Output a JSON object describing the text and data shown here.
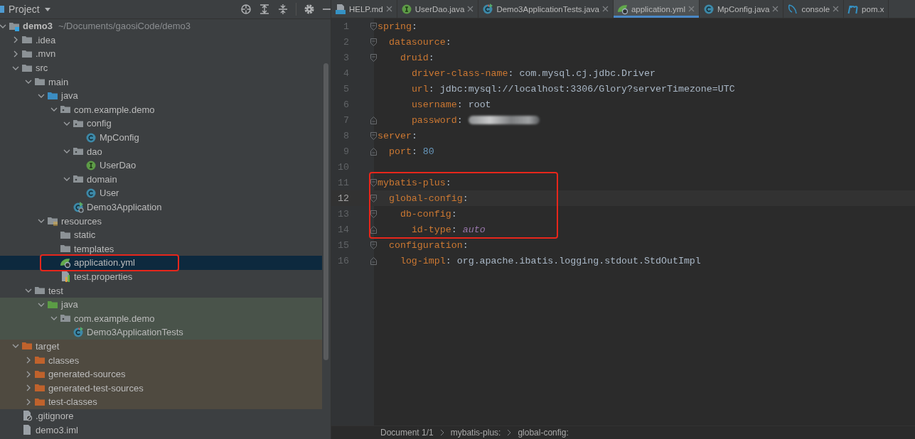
{
  "project": {
    "title": "Project",
    "tree": {
      "name": "demo3",
      "path_hint": "~/Documents/gaosiCode/demo3",
      "kind": "module",
      "expanded": true,
      "selected": false,
      "children": [
        {
          "name": ".idea",
          "kind": "folder",
          "expanded": false,
          "selected": false
        },
        {
          "name": ".mvn",
          "kind": "folder",
          "expanded": false,
          "selected": false
        },
        {
          "name": "src",
          "kind": "folder",
          "expanded": true,
          "selected": false,
          "children": [
            {
              "name": "main",
              "kind": "folder",
              "expanded": true,
              "selected": false,
              "children": [
                {
                  "name": "java",
                  "kind": "source-folder",
                  "expanded": true,
                  "selected": false,
                  "children": [
                    {
                      "name": "com.example.demo",
                      "kind": "package",
                      "expanded": true,
                      "selected": false,
                      "children": [
                        {
                          "name": "config",
                          "kind": "package",
                          "expanded": true,
                          "selected": false,
                          "children": [
                            {
                              "name": "MpConfig",
                              "kind": "class",
                              "selected": false
                            }
                          ]
                        },
                        {
                          "name": "dao",
                          "kind": "package",
                          "expanded": true,
                          "selected": false,
                          "children": [
                            {
                              "name": "UserDao",
                              "kind": "interface",
                              "selected": false
                            }
                          ]
                        },
                        {
                          "name": "domain",
                          "kind": "package",
                          "expanded": true,
                          "selected": false,
                          "children": [
                            {
                              "name": "User",
                              "kind": "class",
                              "selected": false
                            }
                          ]
                        },
                        {
                          "name": "Demo3Application",
                          "kind": "app-class",
                          "selected": false
                        }
                      ]
                    }
                  ]
                },
                {
                  "name": "resources",
                  "kind": "resources",
                  "expanded": true,
                  "selected": false,
                  "children": [
                    {
                      "name": "static",
                      "kind": "folder",
                      "selected": false
                    },
                    {
                      "name": "templates",
                      "kind": "folder",
                      "selected": false
                    },
                    {
                      "name": "application.yml",
                      "kind": "yml",
                      "selected": true,
                      "boxed": true
                    },
                    {
                      "name": "test.properties",
                      "kind": "properties",
                      "selected": false
                    }
                  ]
                }
              ]
            },
            {
              "name": "test",
              "kind": "folder",
              "expanded": true,
              "selected": false,
              "children": [
                {
                  "name": "java",
                  "kind": "test-folder",
                  "test_source": true,
                  "expanded": true,
                  "selected": false,
                  "children": [
                    {
                      "name": "com.example.demo",
                      "kind": "package",
                      "test_source": true,
                      "expanded": true,
                      "selected": false,
                      "children": [
                        {
                          "name": "Demo3ApplicationTests",
                          "kind": "test-class",
                          "test_source": true,
                          "selected": false
                        }
                      ]
                    }
                  ]
                }
              ]
            }
          ]
        },
        {
          "name": "target",
          "kind": "excluded-folder",
          "excluded": true,
          "expanded": true,
          "selected": false,
          "children": [
            {
              "name": "classes",
              "kind": "excluded-folder",
              "excluded": true,
              "expanded": false,
              "selected": false
            },
            {
              "name": "generated-sources",
              "kind": "excluded-folder",
              "excluded": true,
              "expanded": false,
              "selected": false
            },
            {
              "name": "generated-test-sources",
              "kind": "excluded-folder",
              "excluded": true,
              "expanded": false,
              "selected": false
            },
            {
              "name": "test-classes",
              "kind": "excluded-folder",
              "excluded": true,
              "expanded": false,
              "selected": false
            }
          ]
        },
        {
          "name": ".gitignore",
          "kind": "gitignore",
          "selected": false
        },
        {
          "name": "demo3.iml",
          "kind": "iml",
          "selected": false
        }
      ]
    }
  },
  "tabs": [
    {
      "label": "HELP.md",
      "kind": "markdown",
      "selected": false,
      "closable": true
    },
    {
      "label": "UserDao.java",
      "kind": "interface",
      "selected": false,
      "closable": true
    },
    {
      "label": "Demo3ApplicationTests.java",
      "kind": "test-class",
      "selected": false,
      "closable": true
    },
    {
      "label": "application.yml",
      "kind": "yml",
      "selected": true,
      "closable": true
    },
    {
      "label": "MpConfig.java",
      "kind": "class",
      "selected": false,
      "closable": true
    },
    {
      "label": "console",
      "kind": "console",
      "selected": false,
      "closable": true
    },
    {
      "label": "pom.x",
      "kind": "maven",
      "selected": false,
      "closable": false
    }
  ],
  "editor": {
    "lines": [
      {
        "number": "1",
        "current": false,
        "boxed": false,
        "tokens": [
          {
            "kind": "key",
            "text": "spring"
          },
          {
            "kind": "punct",
            "text": ":"
          }
        ],
        "children": [
          {
            "number": "2",
            "current": false,
            "boxed": false,
            "tokens": [
              {
                "kind": "key",
                "text": "datasource"
              },
              {
                "kind": "punct",
                "text": ":"
              }
            ],
            "children": [
              {
                "number": "3",
                "current": false,
                "boxed": false,
                "tokens": [
                  {
                    "kind": "key",
                    "text": "druid"
                  },
                  {
                    "kind": "punct",
                    "text": ":"
                  }
                ],
                "children": [
                  {
                    "number": "4",
                    "current": false,
                    "boxed": false,
                    "tokens": [
                      {
                        "kind": "key",
                        "text": "driver-class-name"
                      },
                      {
                        "kind": "punct",
                        "text": ":"
                      },
                      {
                        "kind": "string",
                        "text": "com.mysql.cj.jdbc.Driver"
                      }
                    ]
                  },
                  {
                    "number": "5",
                    "current": false,
                    "boxed": false,
                    "tokens": [
                      {
                        "kind": "key",
                        "text": "url"
                      },
                      {
                        "kind": "punct",
                        "text": ":"
                      },
                      {
                        "kind": "string",
                        "text": "jdbc:mysql://localhost:3306/Glory?serverTimezone=UTC"
                      }
                    ]
                  },
                  {
                    "number": "6",
                    "current": false,
                    "boxed": false,
                    "tokens": [
                      {
                        "kind": "key",
                        "text": "username"
                      },
                      {
                        "kind": "punct",
                        "text": ":"
                      },
                      {
                        "kind": "string",
                        "text": "root"
                      }
                    ]
                  },
                  {
                    "number": "7",
                    "current": false,
                    "boxed": false,
                    "tokens": [
                      {
                        "kind": "key",
                        "text": "password"
                      },
                      {
                        "kind": "punct",
                        "text": ":"
                      },
                      {
                        "kind": "redacted"
                      }
                    ]
                  }
                ]
              }
            ]
          }
        ]
      },
      {
        "number": "8",
        "current": false,
        "boxed": false,
        "tokens": [
          {
            "kind": "key",
            "text": "server"
          },
          {
            "kind": "punct",
            "text": ":"
          }
        ],
        "children": [
          {
            "number": "9",
            "current": false,
            "boxed": false,
            "tokens": [
              {
                "kind": "key",
                "text": "port"
              },
              {
                "kind": "punct",
                "text": ":"
              },
              {
                "kind": "number",
                "text": "80"
              }
            ]
          }
        ]
      },
      {
        "number": "10",
        "current": false,
        "boxed": false
      },
      {
        "number": "11",
        "current": false,
        "boxed": true,
        "tokens": [
          {
            "kind": "key",
            "text": "mybatis-plus"
          },
          {
            "kind": "punct",
            "text": ":"
          }
        ],
        "children": [
          {
            "number": "12",
            "current": true,
            "boxed": true,
            "tokens": [
              {
                "kind": "key",
                "text": "global-config"
              },
              {
                "kind": "punct",
                "text": ":"
              }
            ],
            "children": [
              {
                "number": "13",
                "current": false,
                "boxed": true,
                "tokens": [
                  {
                    "kind": "key",
                    "text": "db-config"
                  },
                  {
                    "kind": "punct",
                    "text": ":"
                  }
                ],
                "children": [
                  {
                    "number": "14",
                    "current": false,
                    "boxed": true,
                    "tokens": [
                      {
                        "kind": "key",
                        "text": "id-type"
                      },
                      {
                        "kind": "punct",
                        "text": ":"
                      },
                      {
                        "kind": "constant",
                        "text": "auto"
                      }
                    ]
                  }
                ]
              }
            ]
          },
          {
            "number": "15",
            "current": false,
            "boxed": false,
            "tokens": [
              {
                "kind": "key",
                "text": "configuration"
              },
              {
                "kind": "punct",
                "text": ":"
              }
            ],
            "children": [
              {
                "number": "16",
                "current": false,
                "boxed": false,
                "tokens": [
                  {
                    "kind": "key",
                    "text": "log-impl"
                  },
                  {
                    "kind": "punct",
                    "text": ":"
                  },
                  {
                    "kind": "string",
                    "text": "org.apache.ibatis.logging.stdout.StdOutImpl"
                  }
                ]
              }
            ]
          }
        ]
      }
    ],
    "breadcrumbs": [
      "Document 1/1",
      "mybatis-plus:",
      "global-config:"
    ]
  }
}
